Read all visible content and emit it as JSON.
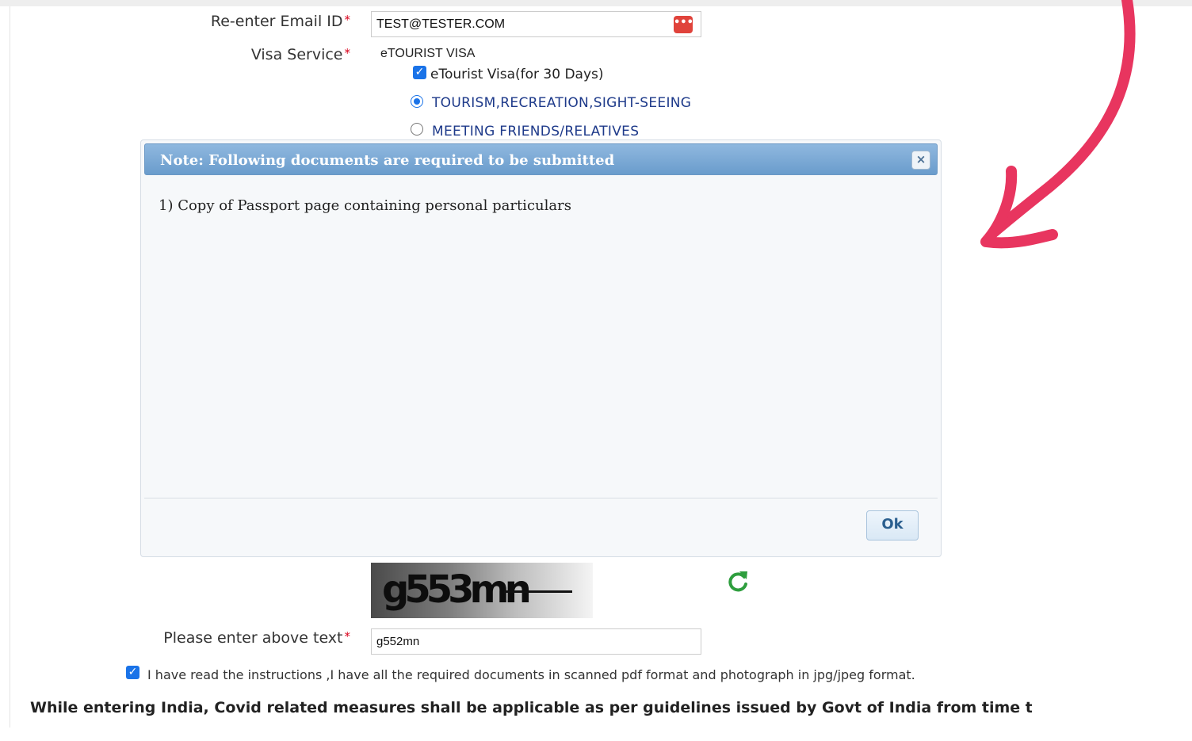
{
  "form": {
    "email_label": "Re-enter Email ID",
    "email_value": "TEST@TESTER.COM",
    "required_mark": "*",
    "visa_service_label": "Visa Service",
    "visa_service_value": "eTOURIST VISA",
    "visa_type_label": "eTourist Visa(for 30 Days)",
    "purpose_options": [
      {
        "label": "TOURISM,RECREATION,SIGHT-SEEING",
        "selected": true
      },
      {
        "label": "MEETING FRIENDS/RELATIVES",
        "selected": false
      }
    ],
    "captcha_text": "g553mn",
    "captcha_label": "Please enter above text",
    "captcha_value": "g552mn",
    "agree_label": "I have read the instructions ,I have all the required documents in scanned pdf format and photograph in jpg/jpeg format.",
    "covid_notice": "While entering India, Covid related measures shall be applicable as per guidelines issued by Govt of India from time to tin"
  },
  "dialog": {
    "title": "Note: Following documents are required to be submitted",
    "items": [
      "1) Copy of Passport page containing personal particulars"
    ],
    "ok_label": "Ok",
    "close_glyph": "×"
  },
  "colors": {
    "annotation_arrow": "#e8355f",
    "checkbox": "#1a73e8",
    "refresh_icon": "#2e9e3e",
    "dialog_header": "#7aa8d6"
  },
  "icons": {
    "password_manager": "key-dots-icon",
    "refresh": "refresh-icon",
    "close": "close-icon",
    "annotation": "curved-arrow-icon"
  }
}
